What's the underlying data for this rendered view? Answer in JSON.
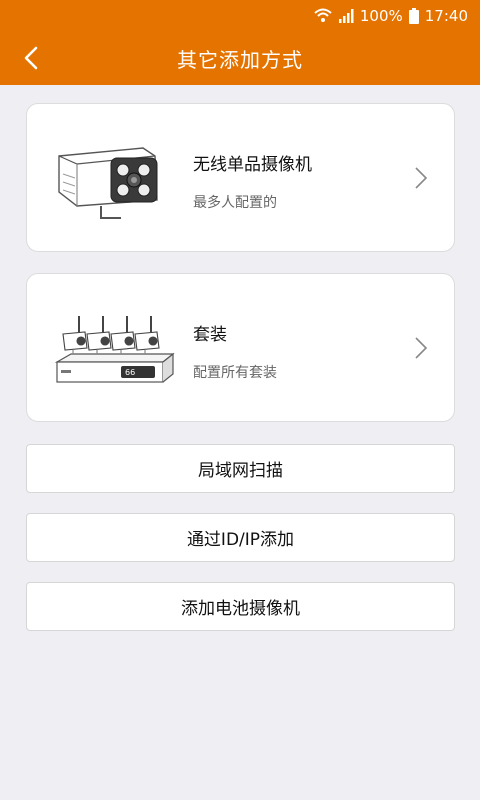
{
  "status": {
    "battery": "100%",
    "time": "17:40"
  },
  "header": {
    "title": "其它添加方式"
  },
  "cards": [
    {
      "title": "无线单品摄像机",
      "subtitle": "最多人配置的",
      "icon": "bullet-camera-image"
    },
    {
      "title": "套装",
      "subtitle": "配置所有套装",
      "icon": "nvr-kit-image"
    }
  ],
  "buttons": [
    {
      "label": "局域网扫描"
    },
    {
      "label": "通过ID/IP添加"
    },
    {
      "label": "添加电池摄像机"
    }
  ],
  "colors": {
    "accent": "#e47300",
    "background": "#efeef3"
  }
}
